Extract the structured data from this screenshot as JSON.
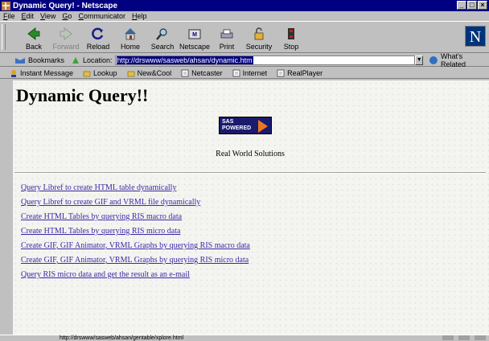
{
  "window": {
    "title": "Dynamic Query! - Netscape",
    "controls": [
      "_",
      "□",
      "×"
    ]
  },
  "menu": [
    {
      "key": "F",
      "rest": "ile"
    },
    {
      "key": "E",
      "rest": "dit"
    },
    {
      "key": "V",
      "rest": "iew"
    },
    {
      "key": "G",
      "rest": "o"
    },
    {
      "key": "C",
      "rest": "ommunicator"
    },
    {
      "key": "H",
      "rest": "elp"
    }
  ],
  "nav": {
    "back": "Back",
    "forward": "Forward",
    "reload": "Reload",
    "home": "Home",
    "search": "Search",
    "netscape": "Netscape",
    "print": "Print",
    "security": "Security",
    "stop": "Stop",
    "logo": "N"
  },
  "location": {
    "bookmarks": "Bookmarks",
    "label": "Location:",
    "url": "http://drswww/sasweb/ahsan/dynamic.htm",
    "related": "What's Related"
  },
  "personal": {
    "items": [
      "Instant Message",
      "Lookup",
      "New&Cool",
      "Netcaster",
      "Internet",
      "RealPlayer"
    ]
  },
  "page": {
    "title": "Dynamic Query!!",
    "logo_line1": "SAS",
    "logo_line2": "POWERED",
    "tagline": "Real World Solutions",
    "links": [
      "Query Libref to create HTML table dynamically",
      "Query Libref to create GIF and VRML file dynamically",
      "Create HTML Tables by querying RIS macro data",
      "Create HTML Tables by querying RIS micro data",
      "Create GIF, GIF Animator, VRML Graphs by querying RIS macro data",
      "Create GIF, GIF Animator, VRML Graphs by querying RIS micro data",
      "Query RIS micro data and get the result as an e-mail"
    ]
  },
  "status": {
    "text": "http://drswww/sasweb/ahsan/gentable/xplore.html"
  },
  "colors": {
    "titlebar": "#000080",
    "link": "#3a2aa8",
    "chrome": "#c0c0c0"
  }
}
